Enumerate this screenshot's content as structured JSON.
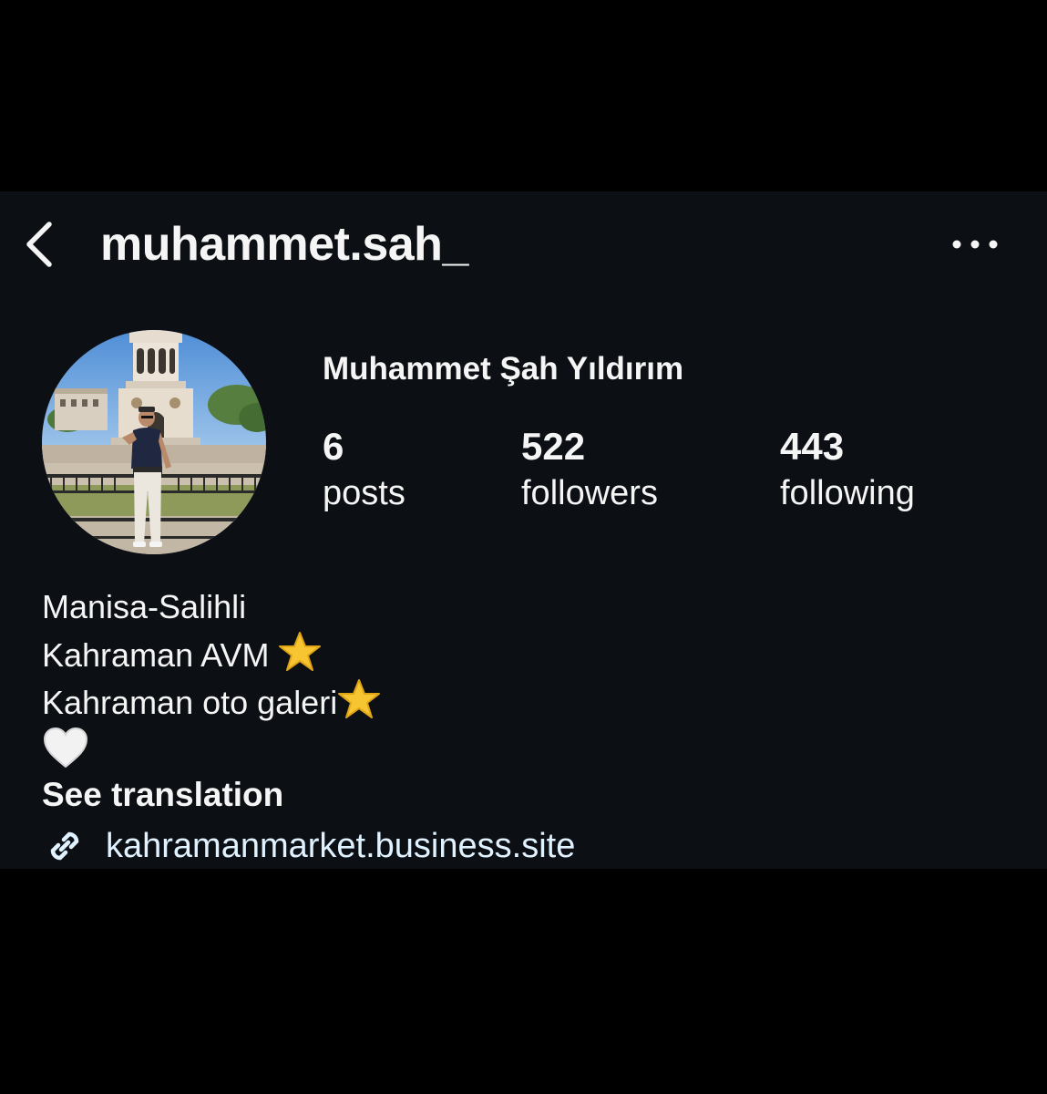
{
  "header": {
    "username": "muhammet.sah_",
    "back_icon": "chevron-left-icon",
    "more_icon": "more-horizontal-icon"
  },
  "profile": {
    "full_name": "Muhammet Şah Yıldırım",
    "avatar_description_icon": "profile-photo",
    "stats": {
      "posts_count": "6",
      "posts_label": "posts",
      "followers_count": "522",
      "followers_label": "followers",
      "following_count": "443",
      "following_label": "following"
    }
  },
  "bio": {
    "line1": "Manisa-Salihli",
    "line2": "Kahraman AVM",
    "line2_emoji": "⭐",
    "line3": "Kahraman oto galeri",
    "line3_emoji": "⭐",
    "line4_emoji": "🤍",
    "see_translation": "See translation"
  },
  "link": {
    "icon": "link-icon",
    "text": "kahramanmarket.business.site"
  },
  "colors": {
    "screen_bg": "#0c1014",
    "outer_bg": "#000000",
    "text": "#f5f5f5",
    "link": "#e0f1ff"
  }
}
